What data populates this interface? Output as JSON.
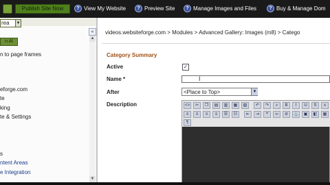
{
  "toolbar": {
    "publish_label": "Publish Site Now",
    "view_website_label": "View My Website",
    "preview_site_label": "Preview Site",
    "manage_images_label": "Manage Images and Files",
    "buy_manage_label": "Buy & Manage Dom",
    "help_glyph": "?"
  },
  "sidebar": {
    "area_select_value": "rea",
    "go_label": "n Al",
    "items": [
      {
        "label": "n to page frames"
      },
      {
        "label": "eforge.com"
      },
      {
        "label": "te"
      },
      {
        "label": "king"
      },
      {
        "label": "te & Settings"
      },
      {
        "label": "s"
      },
      {
        "label": "ntent Areas"
      },
      {
        "label": "e Integration"
      }
    ]
  },
  "main": {
    "breadcrumb": "videos.websiteforge.com > Modules > Advanced Gallery: Images (m8) > Catego",
    "section_title": "Category Summary",
    "fields": {
      "active_label": "Active",
      "active_checked": true,
      "name_label": "Name *",
      "name_value": "",
      "after_label": "After",
      "after_value": "<Place to Top>",
      "description_label": "Description"
    }
  },
  "colors": {
    "toolbar_bg": "#1a1a1a",
    "publish_bg": "#4f7f1c",
    "section_title": "#a34f14",
    "link": "#1a3a8a"
  }
}
